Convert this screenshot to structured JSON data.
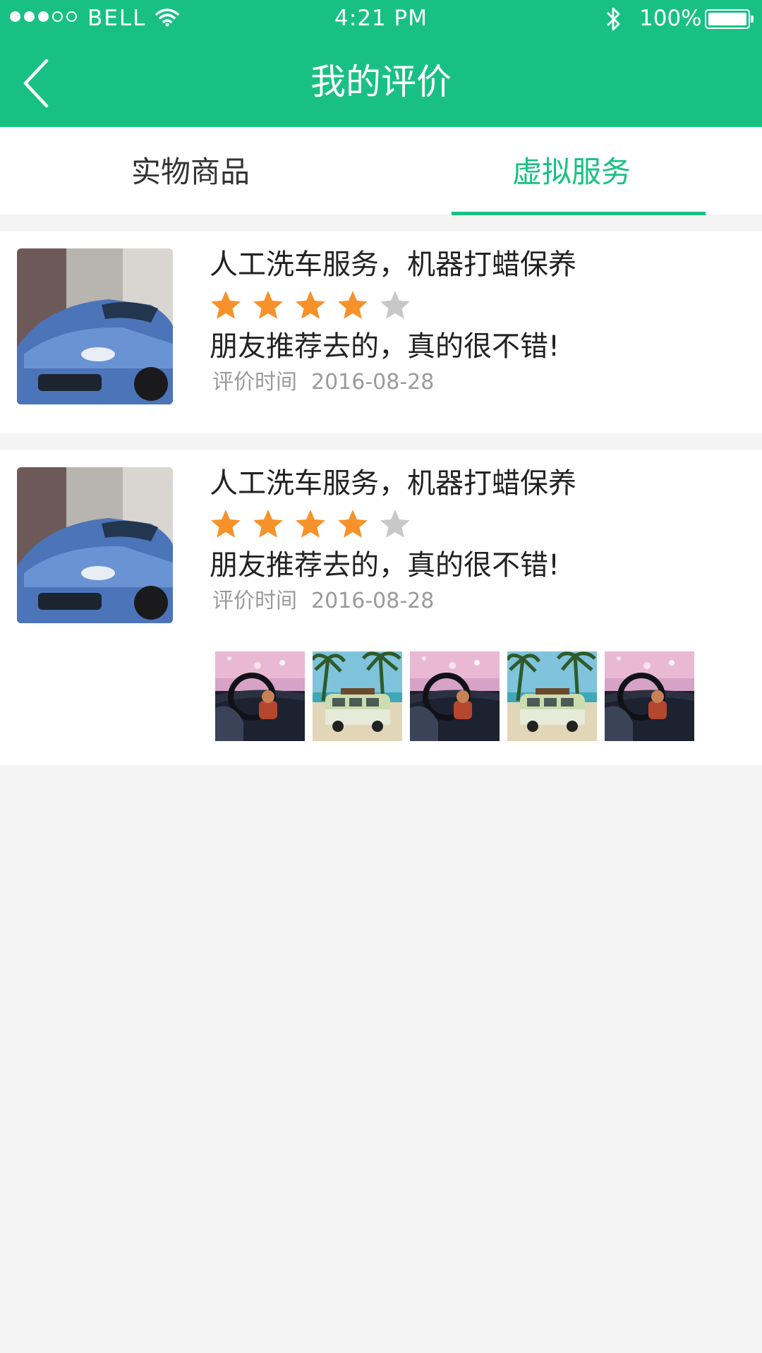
{
  "status_bar": {
    "carrier": "BELL",
    "time": "4:21 PM",
    "battery_percent": "100%",
    "signal_bars_filled": 3,
    "signal_bars_total": 5
  },
  "nav": {
    "title": "我的评价",
    "back_icon": "chevron-left-icon"
  },
  "tabs": [
    {
      "label": "实物商品",
      "active": false
    },
    {
      "label": "虚拟服务",
      "active": true
    }
  ],
  "reviews": [
    {
      "thumbnail": "blue-car-photo",
      "title": "人工洗车服务，机器打蜡保养",
      "rating": 4,
      "rating_max": 5,
      "comment": "朋友推荐去的，真的很不错!",
      "time_label": "评价时间",
      "date": "2016-08-28",
      "photos": []
    },
    {
      "thumbnail": "blue-car-photo",
      "title": "人工洗车服务，机器打蜡保养",
      "rating": 4,
      "rating_max": 5,
      "comment": "朋友推荐去的，真的很不错!",
      "time_label": "评价时间",
      "date": "2016-08-28",
      "photos": [
        "car-interior-photo",
        "beach-van-photo",
        "car-interior-photo",
        "beach-van-photo",
        "car-interior-photo"
      ]
    }
  ],
  "colors": {
    "brand_green": "#18c183",
    "star_filled": "#f7922a",
    "star_empty": "#c8c8c8",
    "background": "#f4f4f4"
  }
}
